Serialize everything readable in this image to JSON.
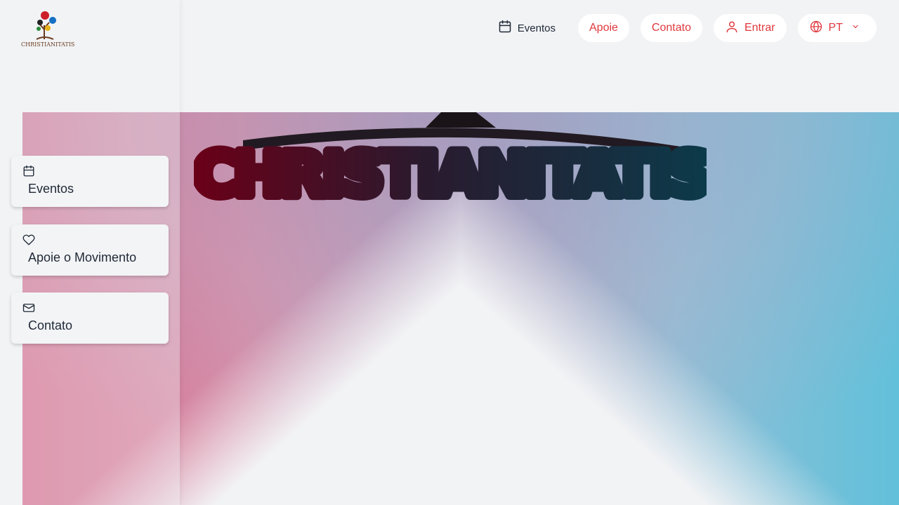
{
  "brand": {
    "logo_text": "CHRISTIANITATIS",
    "hero_title": "CHRISTIANITATIS"
  },
  "header": {
    "events_label": "Eventos",
    "support_label": "Apoie",
    "contact_label": "Contato",
    "login_label": "Entrar",
    "language_label": "PT"
  },
  "sidebar": {
    "items": [
      {
        "icon": "calendar-icon",
        "label": "Eventos"
      },
      {
        "icon": "heart-icon",
        "label": "Apoie o Movimento"
      },
      {
        "icon": "mail-icon",
        "label": "Contato"
      }
    ]
  },
  "colors": {
    "accent": "#e0383e",
    "text": "#1f2937",
    "background": "#f2f3f5",
    "hero_pink": "#d4698a",
    "hero_blue": "#62c0da",
    "title_red": "#6a0018",
    "title_teal": "#0c3a4a"
  }
}
